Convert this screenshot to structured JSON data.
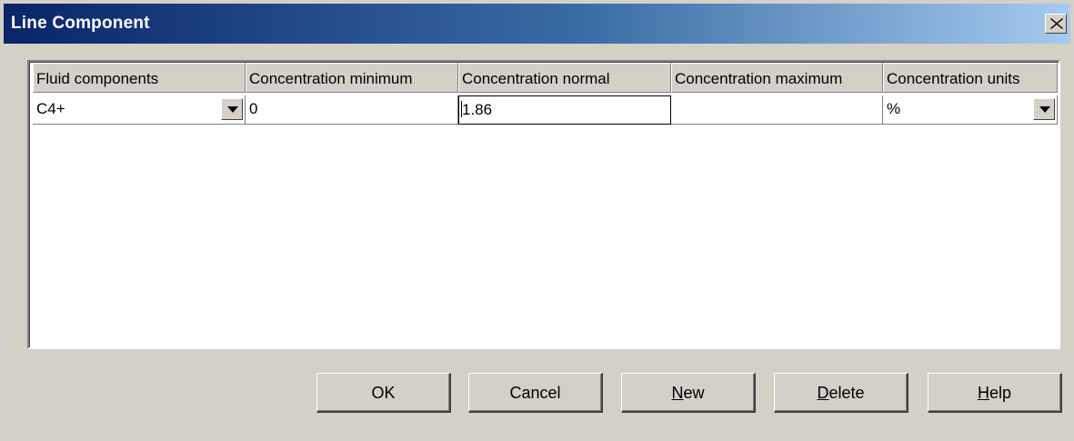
{
  "window": {
    "title": "Line Component",
    "close_glyph": "×"
  },
  "grid": {
    "columns": [
      "Fluid components",
      "Concentration minimum",
      "Concentration normal",
      "Concentration maximum",
      "Concentration units"
    ],
    "rows": [
      {
        "fluid_component": "C4+",
        "concentration_minimum": "0",
        "concentration_normal": "1.86",
        "concentration_maximum": "",
        "concentration_units": "%"
      }
    ]
  },
  "buttons": {
    "ok": "OK",
    "cancel": "Cancel",
    "new_mnemonic": "N",
    "new_rest": "ew",
    "delete_mnemonic": "D",
    "delete_rest": "elete",
    "help_mnemonic": "H",
    "help_rest": "elp"
  },
  "colors": {
    "title_gradient_start": "#0a246a",
    "title_gradient_end": "#a6caf0",
    "face": "#d4d0c8"
  }
}
